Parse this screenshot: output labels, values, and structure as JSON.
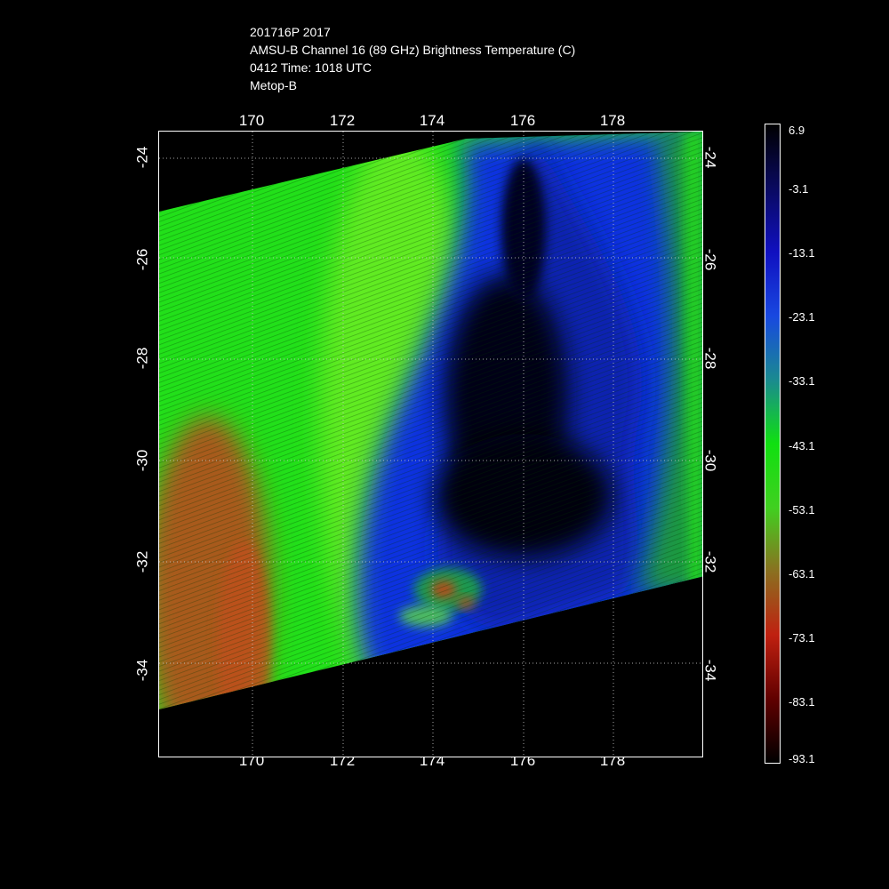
{
  "header": {
    "line1": "201716P 2017",
    "line2": "AMSU-B Channel 16 (89 GHz) Brightness Temperature (C)",
    "line3": "0412 Time: 1018 UTC",
    "line4": "Metop-B"
  },
  "lon_ticks": [
    "170",
    "172",
    "174",
    "176",
    "178"
  ],
  "lat_ticks": [
    "-24",
    "-26",
    "-28",
    "-30",
    "-32",
    "-34"
  ],
  "colorbar": {
    "labels": [
      "6.9",
      "-3.1",
      "-13.1",
      "-23.1",
      "-33.1",
      "-43.1",
      "-53.1",
      "-63.1",
      "-73.1",
      "-83.1",
      "-93.1"
    ],
    "colors": [
      "#000000",
      "#0a0a60",
      "#1010c0",
      "#1848e0",
      "#1a8a90",
      "#10e010",
      "#40d020",
      "#8a7020",
      "#c02010",
      "#600000",
      "#000000"
    ]
  }
}
